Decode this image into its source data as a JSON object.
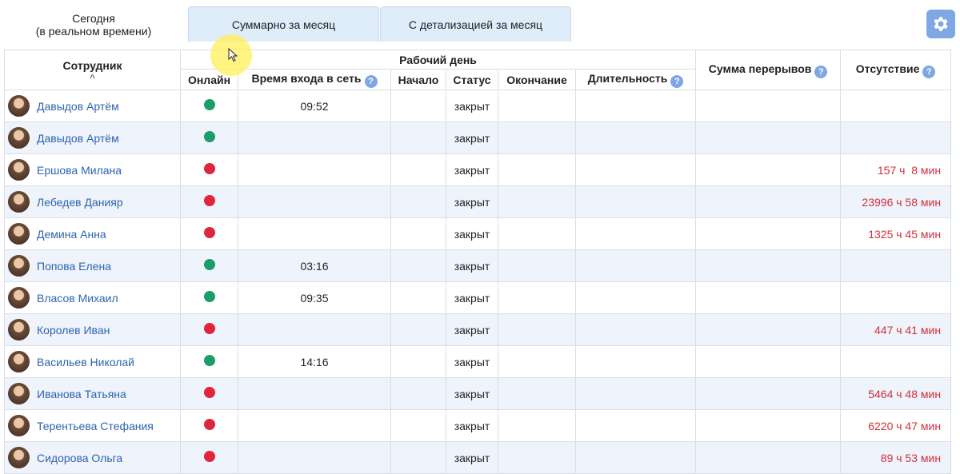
{
  "tabs": [
    {
      "line1": "Сегодня",
      "line2": "(в реальном времени)",
      "active": true
    },
    {
      "line1": "Суммарно за месяц",
      "active": false
    },
    {
      "line1": "С детализацией за месяц",
      "active": false
    }
  ],
  "settings": {
    "icon": "gear-icon"
  },
  "table": {
    "headers": {
      "employee": "Сотрудник",
      "sort_indicator": "^",
      "workday": "Рабочий день",
      "online": "Онлайн",
      "login_time": "Время входа в сеть",
      "start": "Начало",
      "status": "Статус",
      "end": "Окончание",
      "duration": "Длительность",
      "breaks": "Сумма перерывов",
      "absence": "Отсутствие",
      "help_glyph": "?"
    },
    "colors": {
      "online": "#1a9e6a",
      "offline": "#e0263a",
      "link": "#2f64ad",
      "absence": "#d0303a"
    },
    "rows": [
      {
        "name": "Давыдов Артём",
        "online": true,
        "login": "09:52",
        "start": "",
        "status": "закрыт",
        "end": "",
        "duration": "",
        "breaks": "",
        "absence": ""
      },
      {
        "name": "Давыдов Артём",
        "online": true,
        "login": "",
        "start": "",
        "status": "закрыт",
        "end": "",
        "duration": "",
        "breaks": "",
        "absence": ""
      },
      {
        "name": "Ершова Милана",
        "online": false,
        "login": "",
        "start": "",
        "status": "закрыт",
        "end": "",
        "duration": "",
        "breaks": "",
        "absence": "157 ч  8 мин"
      },
      {
        "name": "Лебедев Данияр",
        "online": false,
        "login": "",
        "start": "",
        "status": "закрыт",
        "end": "",
        "duration": "",
        "breaks": "",
        "absence": "23996 ч 58 мин"
      },
      {
        "name": "Демина Анна",
        "online": false,
        "login": "",
        "start": "",
        "status": "закрыт",
        "end": "",
        "duration": "",
        "breaks": "",
        "absence": "1325 ч 45 мин"
      },
      {
        "name": "Попова Елена",
        "online": true,
        "login": "03:16",
        "start": "",
        "status": "закрыт",
        "end": "",
        "duration": "",
        "breaks": "",
        "absence": ""
      },
      {
        "name": "Власов Михаил",
        "online": true,
        "login": "09:35",
        "start": "",
        "status": "закрыт",
        "end": "",
        "duration": "",
        "breaks": "",
        "absence": ""
      },
      {
        "name": "Королев Иван",
        "online": false,
        "login": "",
        "start": "",
        "status": "закрыт",
        "end": "",
        "duration": "",
        "breaks": "",
        "absence": "447 ч 41 мин"
      },
      {
        "name": "Васильев Николай",
        "online": true,
        "login": "14:16",
        "start": "",
        "status": "закрыт",
        "end": "",
        "duration": "",
        "breaks": "",
        "absence": ""
      },
      {
        "name": "Иванова Татьяна",
        "online": false,
        "login": "",
        "start": "",
        "status": "закрыт",
        "end": "",
        "duration": "",
        "breaks": "",
        "absence": "5464 ч 48 мин"
      },
      {
        "name": "Терентьева Стефания",
        "online": false,
        "login": "",
        "start": "",
        "status": "закрыт",
        "end": "",
        "duration": "",
        "breaks": "",
        "absence": "6220 ч 47 мин"
      },
      {
        "name": "Сидорова Ольга",
        "online": false,
        "login": "",
        "start": "",
        "status": "закрыт",
        "end": "",
        "duration": "",
        "breaks": "",
        "absence": "89 ч 53 мин"
      }
    ]
  }
}
